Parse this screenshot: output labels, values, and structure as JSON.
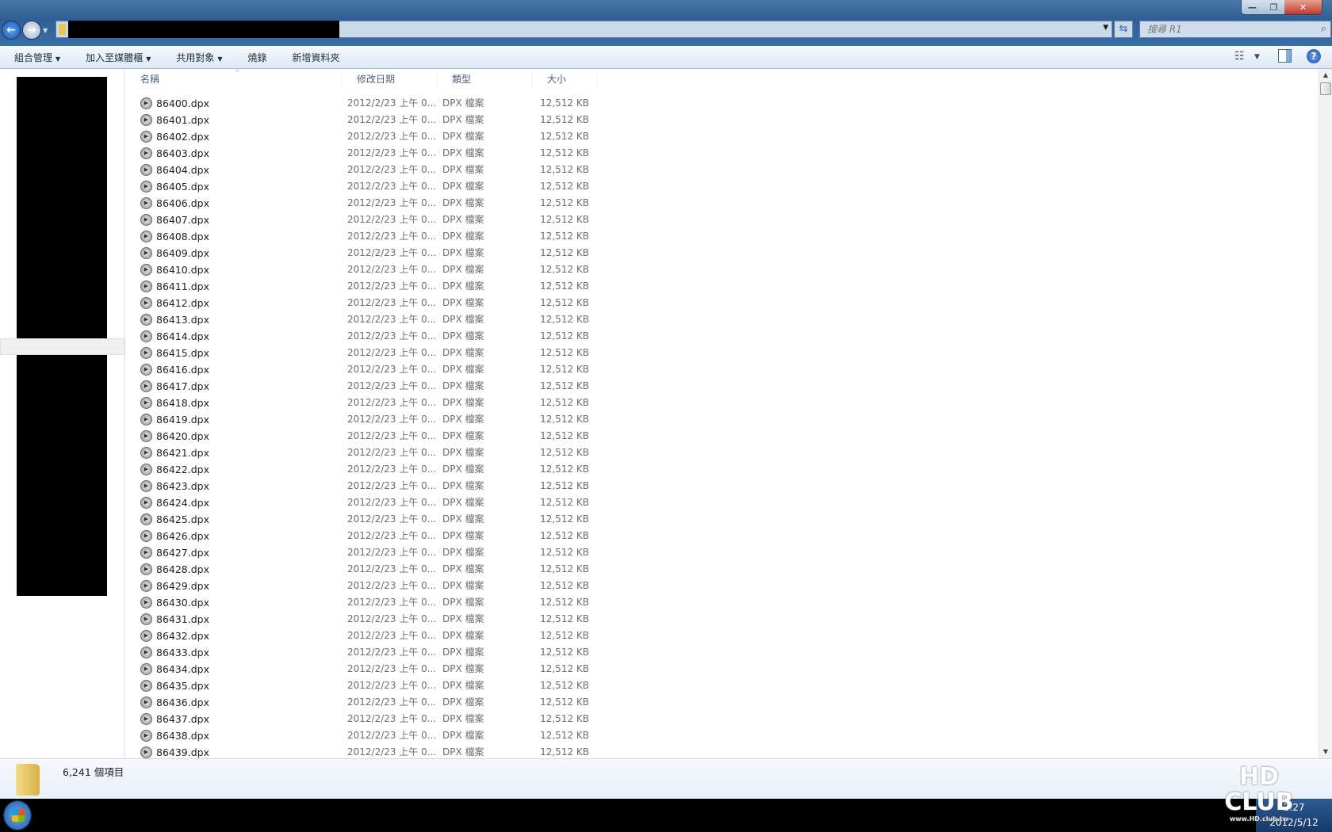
{
  "window": {
    "minimize": "—",
    "maximize": "❐",
    "close": "✕"
  },
  "address": {
    "search_placeholder": "搜尋 R1"
  },
  "toolbar": {
    "items": [
      {
        "label": "組合管理",
        "dropdown": true
      },
      {
        "label": "加入至媒體櫃",
        "dropdown": true
      },
      {
        "label": "共用對象",
        "dropdown": true
      },
      {
        "label": "燒錄",
        "dropdown": false
      },
      {
        "label": "新增資料夾",
        "dropdown": false
      }
    ],
    "view_icon": "☷",
    "help": "?"
  },
  "columns": {
    "name": "名稱",
    "modified": "修改日期",
    "type": "類型",
    "size": "大小"
  },
  "files": [],
  "file_common": {
    "modified": "2012/2/23 上午 0...",
    "type": "DPX 檔案",
    "size": "12,512 KB",
    "first": 86400,
    "count": 40,
    "ext": ".dpx"
  },
  "status": {
    "item_count": "6,241 個項目"
  },
  "watermark": {
    "logo": "HD",
    "sub": "CLUB",
    "url": "www.HD.club.tw"
  },
  "taskbar": {
    "time": "2:27",
    "date": "2012/5/12"
  }
}
